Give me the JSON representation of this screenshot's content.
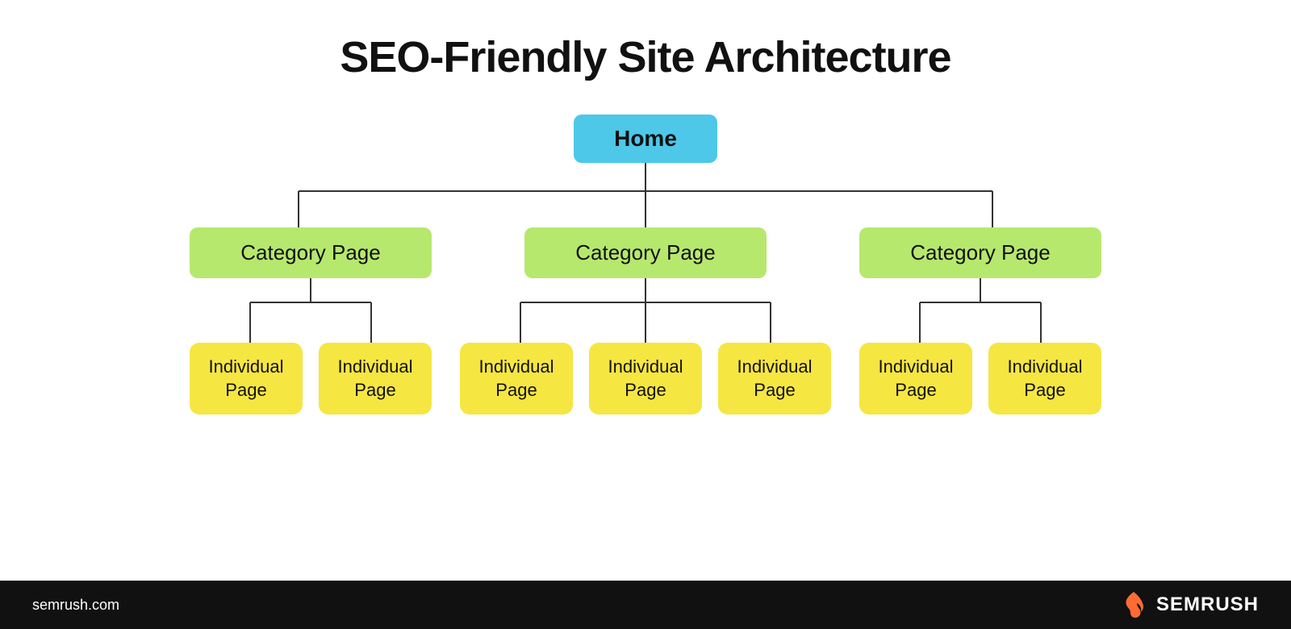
{
  "title": "SEO-Friendly Site Architecture",
  "home_label": "Home",
  "category_label": "Category Page",
  "individual_label": "Individual Page",
  "colors": {
    "home_bg": "#4dc8e8",
    "category_bg": "#b6e86e",
    "individual_bg": "#f5e642"
  },
  "footer": {
    "url": "semrush.com",
    "brand": "SEMRUSH"
  },
  "columns": [
    {
      "id": "left",
      "category": "Category Page",
      "individuals": [
        "Individual Page",
        "Individual Page"
      ]
    },
    {
      "id": "middle",
      "category": "Category Page",
      "individuals": [
        "Individual Page",
        "Individual Page",
        "Individual Page"
      ]
    },
    {
      "id": "right",
      "category": "Category Page",
      "individuals": [
        "Individual Page",
        "Individual Page"
      ]
    }
  ]
}
